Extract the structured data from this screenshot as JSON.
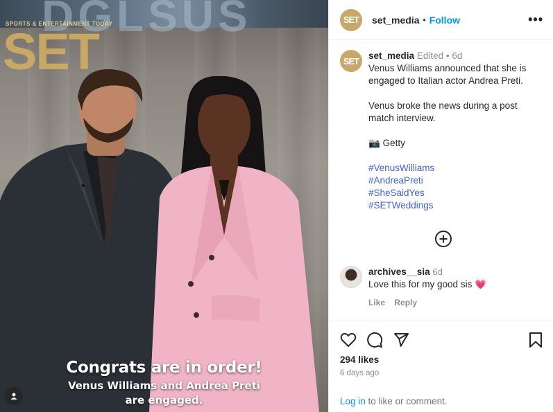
{
  "media": {
    "brand_tagline": "SPORTS & ENTERTAINMENT TODAY",
    "brand_logo": "SET",
    "caption_line1": "Congrats are in order!",
    "caption_line2": "Venus Williams and Andrea Preti",
    "caption_line3": "are engaged.",
    "tag_icon": "user-tag-icon"
  },
  "header": {
    "avatar_text": "SET",
    "username": "set_media",
    "separator": "•",
    "follow_label": "Follow",
    "more_label": "•••"
  },
  "post": {
    "avatar_text": "SET",
    "username": "set_media",
    "edited": "Edited",
    "separator": "•",
    "age": "6d",
    "line1": "Venus Williams announced that she is engaged to Italian actor Andrea Preti.",
    "line2": "Venus broke the news during a post match interview.",
    "credit_icon": "📷",
    "credit": "Getty",
    "hashtags": [
      "#VenusWilliams",
      "#AndreaPreti",
      "#SheSaidYes",
      "#SETWeddings"
    ]
  },
  "more_comments_icon": "plus-circle-icon",
  "comment": {
    "username": "archives__sia",
    "age": "6d",
    "text": "Love this for my good sis",
    "emoji": "💗",
    "like_label": "Like",
    "reply_label": "Reply"
  },
  "footer": {
    "likes": "294 likes",
    "ago": "6 days ago",
    "login_link": "Log in",
    "login_rest": " to like or comment."
  },
  "colors": {
    "brand_gold": "#c7a86a",
    "link_blue": "#0095f6",
    "hashtag_blue": "#4063d6"
  }
}
